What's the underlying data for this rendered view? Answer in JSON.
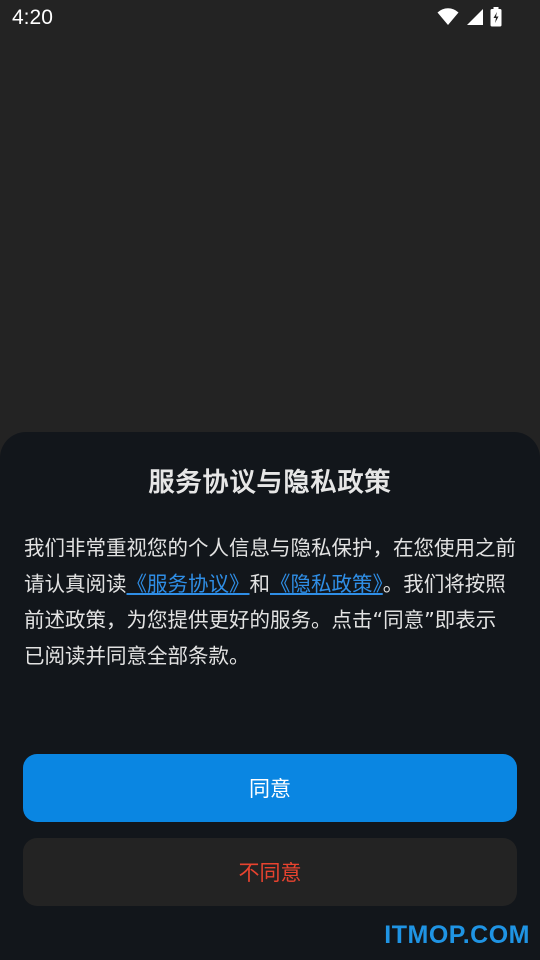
{
  "status_bar": {
    "time": "4:20",
    "icons": [
      "wifi-icon",
      "signal-icon",
      "battery-charging-icon"
    ]
  },
  "dialog": {
    "title": "服务协议与隐私政策",
    "body": {
      "part1": "我们非常重视您的个人信息与隐私保护，在您使用之前请认真阅读",
      "link_terms": "《服务协议》",
      "part2": "和",
      "link_privacy": "《隐私政策》",
      "part3": "。我们将按照前述政策，为您提供更好的服务。点击“同意”即表示已阅读并同意全部条款。"
    },
    "agree_label": "同意",
    "disagree_label": "不同意"
  },
  "watermark": "ITMOP.COM",
  "colors": {
    "background": "#232323",
    "sheet": "#12161b",
    "accent": "#0a86e2",
    "link": "#2f8ee6",
    "danger": "#e8432f",
    "watermark": "#1f94e4"
  }
}
